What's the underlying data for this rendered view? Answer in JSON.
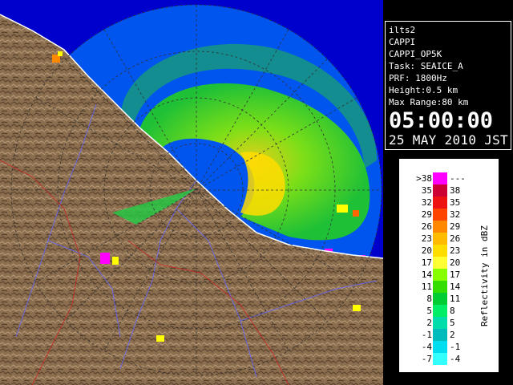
{
  "info": {
    "station": "ilts2",
    "product": "CAPPI",
    "product_code": "CAPPI_OP5K",
    "task": "Task: SEAICE_A",
    "prf": "PRF: 1800Hz",
    "height": "Height:0.5 km",
    "max_range": "Max Range:80 km",
    "time": "05:00:00",
    "date": "25 MAY 2010 JST"
  },
  "legend": {
    "axis_label": "Reflectivity in dBZ",
    "rows": [
      {
        "low": ">38",
        "high": "---",
        "color": "#ff00ff"
      },
      {
        "low": "35",
        "high": "38",
        "color": "#cc0033"
      },
      {
        "low": "32",
        "high": "35",
        "color": "#ee1111"
      },
      {
        "low": "29",
        "high": "32",
        "color": "#ff4400"
      },
      {
        "low": "26",
        "high": "29",
        "color": "#ff8800"
      },
      {
        "low": "23",
        "high": "26",
        "color": "#ffbb00"
      },
      {
        "low": "20",
        "high": "23",
        "color": "#ffdd00"
      },
      {
        "low": "17",
        "high": "20",
        "color": "#ffff33"
      },
      {
        "low": "14",
        "high": "17",
        "color": "#88ff00"
      },
      {
        "low": "11",
        "high": "14",
        "color": "#33dd00"
      },
      {
        "low": "8",
        "high": "11",
        "color": "#00cc33"
      },
      {
        "low": "5",
        "high": "8",
        "color": "#00ee66"
      },
      {
        "low": "2",
        "high": "5",
        "color": "#00ddaa"
      },
      {
        "low": "-1",
        "high": "2",
        "color": "#00bbbb"
      },
      {
        "low": "-4",
        "high": "-1",
        "color": "#00ddee"
      },
      {
        "low": "-7",
        "high": "-4",
        "color": "#33ffff"
      }
    ]
  },
  "map": {
    "ocean_color": "#0000cc",
    "radar_bg_color": "#0055ee",
    "land_color": "#8b6e4e"
  }
}
